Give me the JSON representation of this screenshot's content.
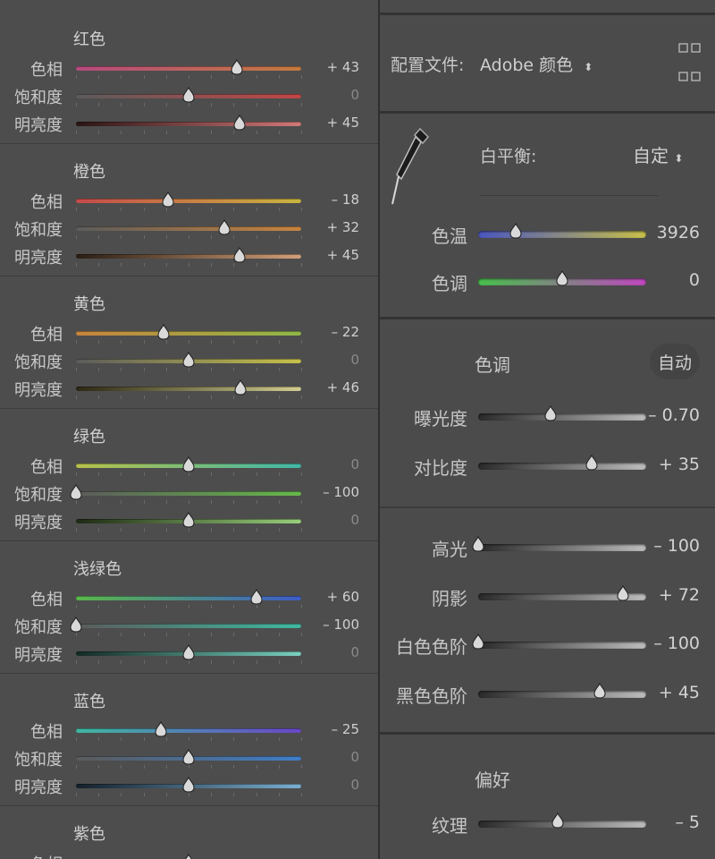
{
  "hsl_groups": [
    {
      "title": "红色",
      "rows": [
        {
          "label": "色相",
          "value": "+ 43",
          "level": 0.43,
          "colors": [
            "#b64a7e",
            "#c47a3e"
          ]
        },
        {
          "label": "饱和度",
          "value": "0",
          "level": 0,
          "colors": [
            "#5b5b5b",
            "#c24646"
          ]
        },
        {
          "label": "明亮度",
          "value": "+ 45",
          "level": 0.45,
          "colors": [
            "#2a1414",
            "#d17878"
          ]
        }
      ]
    },
    {
      "title": "橙色",
      "rows": [
        {
          "label": "色相",
          "value": "– 18",
          "level": -0.18,
          "colors": [
            "#c64a4a",
            "#c8b43e"
          ]
        },
        {
          "label": "饱和度",
          "value": "+ 32",
          "level": 0.32,
          "colors": [
            "#5b5b5b",
            "#c8843e"
          ]
        },
        {
          "label": "明亮度",
          "value": "+ 45",
          "level": 0.45,
          "colors": [
            "#2a1e14",
            "#d2a07a"
          ]
        }
      ]
    },
    {
      "title": "黄色",
      "rows": [
        {
          "label": "色相",
          "value": "– 22",
          "level": -0.22,
          "colors": [
            "#c8843e",
            "#8fb846"
          ]
        },
        {
          "label": "饱和度",
          "value": "0",
          "level": 0,
          "colors": [
            "#5b5b5b",
            "#c7c049"
          ]
        },
        {
          "label": "明亮度",
          "value": "+ 46",
          "level": 0.46,
          "colors": [
            "#2a2814",
            "#d2cd90"
          ]
        }
      ]
    },
    {
      "title": "绿色",
      "rows": [
        {
          "label": "色相",
          "value": "0",
          "level": 0,
          "colors": [
            "#b8c04a",
            "#40b8a8"
          ]
        },
        {
          "label": "饱和度",
          "value": "– 100",
          "level": -1,
          "colors": [
            "#5b5b5b",
            "#66b84a"
          ]
        },
        {
          "label": "明亮度",
          "value": "0",
          "level": 0,
          "colors": [
            "#1e2a14",
            "#98d07a"
          ]
        }
      ]
    },
    {
      "title": "浅绿色",
      "rows": [
        {
          "label": "色相",
          "value": "+ 60",
          "level": 0.6,
          "colors": [
            "#5ab84a",
            "#3e5cc8"
          ]
        },
        {
          "label": "饱和度",
          "value": "– 100",
          "level": -1,
          "colors": [
            "#5b5b5b",
            "#3eb8a0"
          ]
        },
        {
          "label": "明亮度",
          "value": "0",
          "level": 0,
          "colors": [
            "#142a24",
            "#7ad0c0"
          ]
        }
      ]
    },
    {
      "title": "蓝色",
      "rows": [
        {
          "label": "色相",
          "value": "– 25",
          "level": -0.25,
          "colors": [
            "#3eb8a0",
            "#6a46c8"
          ]
        },
        {
          "label": "饱和度",
          "value": "0",
          "level": 0,
          "colors": [
            "#5b5b5b",
            "#3e7ec8"
          ]
        },
        {
          "label": "明亮度",
          "value": "0",
          "level": 0,
          "colors": [
            "#14202a",
            "#7aaed0"
          ]
        }
      ]
    },
    {
      "title": "紫色",
      "rows": [
        {
          "label": "色相",
          "value": "",
          "level": 0,
          "colors": [
            "#3e5cc8",
            "#b846b0"
          ]
        }
      ]
    }
  ],
  "profile": {
    "label": "配置文件:",
    "value": "Adobe 颜色",
    "grid_icon": "grid-icon"
  },
  "white_balance": {
    "label": "白平衡:",
    "mode": "自定",
    "eyedropper_icon": "eyedropper-icon",
    "rows": [
      {
        "label": "色温",
        "value": "3926",
        "level": -0.55,
        "colors": [
          "#4a56c0",
          "#c8c04a"
        ]
      },
      {
        "label": "色调",
        "value": "0",
        "level": 0,
        "colors": [
          "#46c04a",
          "#c046c0"
        ]
      }
    ]
  },
  "tone": {
    "title": "色调",
    "auto": "自动",
    "rows1": [
      {
        "label": "曝光度",
        "value": "– 0.70",
        "level": -0.14,
        "colors": [
          "#2a2a2a",
          "#bdbdbd"
        ]
      },
      {
        "label": "对比度",
        "value": "+ 35",
        "level": 0.35,
        "colors": [
          "#2a2a2a",
          "#bdbdbd"
        ]
      }
    ],
    "rows2": [
      {
        "label": "高光",
        "value": "– 100",
        "level": -1,
        "colors": [
          "#2a2a2a",
          "#bdbdbd"
        ]
      },
      {
        "label": "阴影",
        "value": "+ 72",
        "level": 0.72,
        "colors": [
          "#2a2a2a",
          "#bdbdbd"
        ]
      },
      {
        "label": "白色色阶",
        "value": "– 100",
        "level": -1,
        "colors": [
          "#2a2a2a",
          "#bdbdbd"
        ]
      },
      {
        "label": "黑色色阶",
        "value": "+ 45",
        "level": 0.45,
        "colors": [
          "#2a2a2a",
          "#bdbdbd"
        ]
      }
    ]
  },
  "presence": {
    "title": "偏好",
    "rows": [
      {
        "label": "纹理",
        "value": "– 5",
        "level": -0.05,
        "colors": [
          "#2a2a2a",
          "#bdbdbd"
        ]
      }
    ]
  }
}
